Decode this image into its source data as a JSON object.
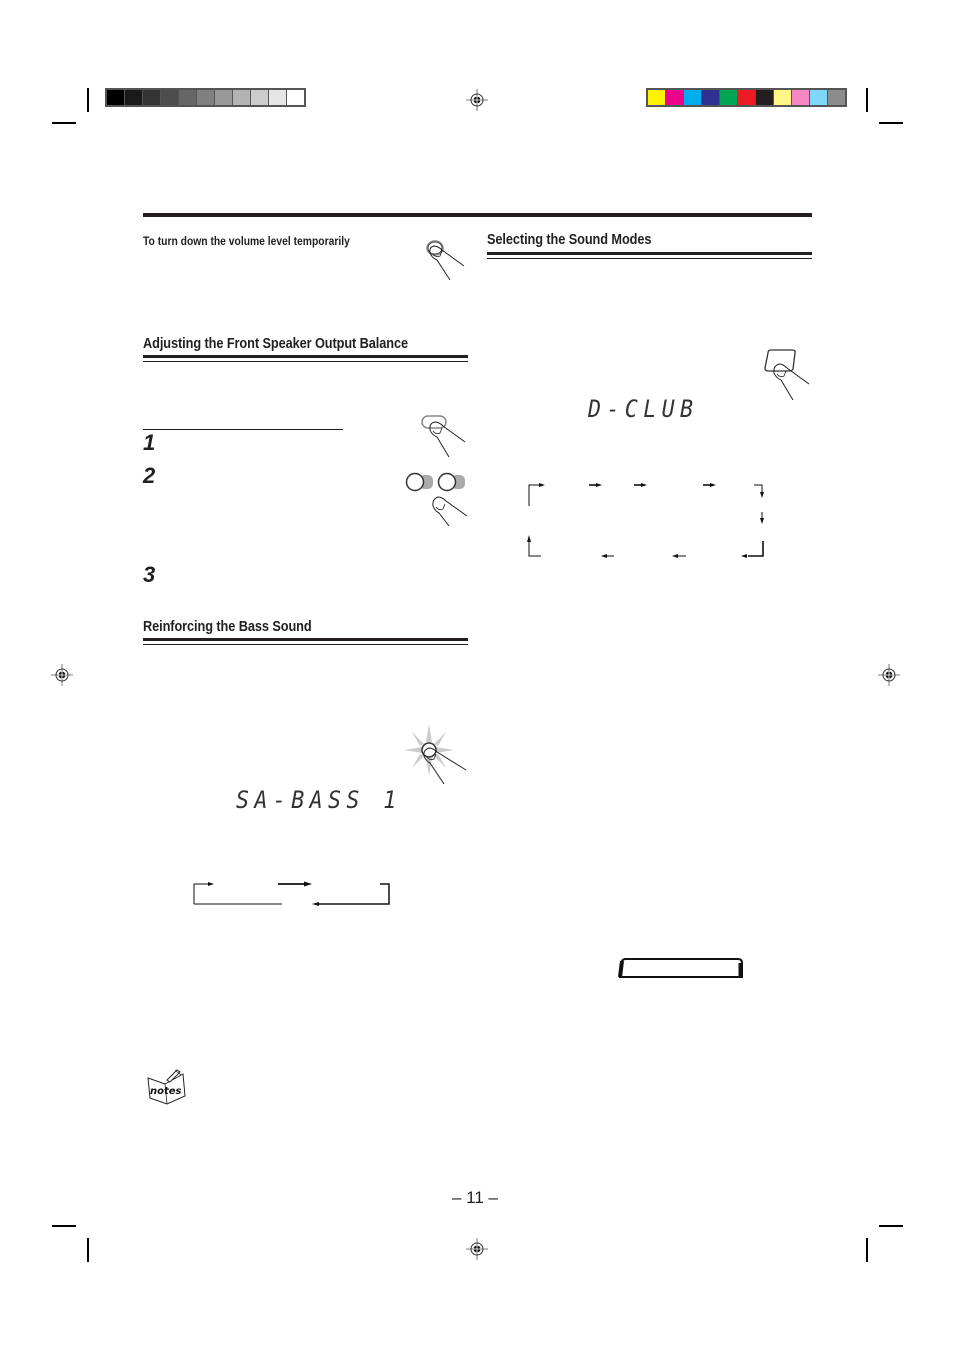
{
  "print_marks": {
    "grayscale_bar": [
      "#000000",
      "#1a1a1a",
      "#333333",
      "#4d4d4d",
      "#666666",
      "#808080",
      "#999999",
      "#b3b3b3",
      "#cccccc",
      "#e6e6e6",
      "#ffffff"
    ],
    "color_bar": [
      "#fff200",
      "#ec008c",
      "#00aeef",
      "#2e3192",
      "#00a651",
      "#ed1c24",
      "#231f20",
      "#fff685",
      "#f587c5",
      "#7fd7f7",
      "#8c8c8c"
    ]
  },
  "left_column": {
    "mute_subheading": "To turn down the volume level temporarily",
    "balance_heading": "Adjusting the Front Speaker Output Balance",
    "steps": [
      "1",
      "2",
      "3"
    ],
    "bass_heading": "Reinforcing the Bass Sound",
    "bass_display": "SA-BASS 1",
    "notes_label": "notes"
  },
  "right_column": {
    "sound_modes_heading": "Selecting the Sound Modes",
    "sound_mode_display": "D-CLUB"
  },
  "footer": {
    "page_number": "– 11 –"
  },
  "icons": {
    "mute_button": "finger-press-button-icon",
    "balance_button": "finger-press-button-icon",
    "balance_adjust_buttons": "finger-press-two-buttons-icon",
    "sound_mode_button": "finger-press-square-button-icon",
    "bass_button": "finger-press-lit-button-icon",
    "notes": "notes-book-icon"
  }
}
